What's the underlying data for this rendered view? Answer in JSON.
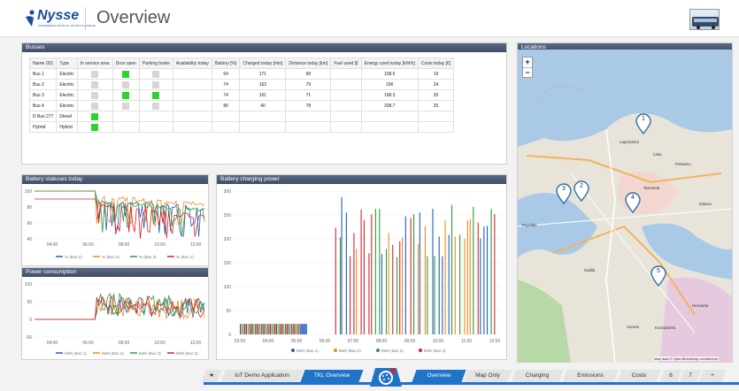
{
  "header": {
    "brand": "Nysse",
    "brand_sub": "TAMPEREEN SEUDUN JOUKKOLIIKENNE",
    "title": "Overview"
  },
  "busses_panel": {
    "title": "Busses",
    "columns": [
      "Name (ID)",
      "Type",
      "In service area",
      "Door open",
      "Parking brake",
      "Availability today",
      "Battery [%]",
      "Charged today [min]",
      "Distance today [km]",
      "Fuel used [l]",
      "Energy used today [kW/h]",
      "Costs today [€]"
    ],
    "rows": [
      {
        "name": "Bus 1",
        "type": "Electric",
        "in_service": "off",
        "door_open": "on",
        "parking_brake": "off",
        "availability": "",
        "battery": "64",
        "charged": "171",
        "distance": "68",
        "fuel": "",
        "energy": "158.5",
        "costs": "19"
      },
      {
        "name": "Bus 2",
        "type": "Electric",
        "in_service": "off",
        "door_open": "off",
        "parking_brake": "off",
        "availability": "",
        "battery": "74",
        "charged": "163",
        "distance": "79",
        "fuel": "",
        "energy": "196",
        "costs": "24"
      },
      {
        "name": "Bus 3",
        "type": "Electric",
        "in_service": "off",
        "door_open": "on",
        "parking_brake": "on",
        "availability": "",
        "battery": "74",
        "charged": "161",
        "distance": "71",
        "fuel": "",
        "energy": "168.3",
        "costs": "20"
      },
      {
        "name": "Bus 4",
        "type": "Electric",
        "in_service": "off",
        "door_open": "off",
        "parking_brake": "off",
        "availability": "",
        "battery": "80",
        "charged": "40",
        "distance": "78",
        "fuel": "",
        "energy": "208.7",
        "costs": "25"
      },
      {
        "name": "D Bus 277",
        "type": "Diesel",
        "in_service": "on",
        "door_open": "",
        "parking_brake": "",
        "availability": "",
        "battery": "",
        "charged": "",
        "distance": "",
        "fuel": "",
        "energy": "",
        "costs": ""
      },
      {
        "name": "Hybrid",
        "type": "Hybrid",
        "in_service": "on",
        "door_open": "",
        "parking_brake": "",
        "availability": "",
        "battery": "",
        "charged": "",
        "distance": "",
        "fuel": "",
        "energy": "",
        "costs": ""
      }
    ]
  },
  "battery_panel": {
    "title": "Battery statuses today"
  },
  "power_panel": {
    "title": "Power consumption"
  },
  "charging_panel": {
    "title": "Battery charging power"
  },
  "locations_panel": {
    "title": "Locations",
    "zoom_in": "+",
    "zoom_out": "−",
    "attribution": "Map data © OpenStreetMap contributors",
    "pins": [
      "1",
      "2",
      "3",
      "4",
      "5"
    ],
    "labels": [
      "Lapinniemi",
      "Lielu",
      "Petsamo",
      "Kaleva",
      "Tammela",
      "Pyynikki",
      "Hervanta",
      "Vuores",
      "Kovvaniemi",
      "Hallila"
    ]
  },
  "chart_data": [
    {
      "type": "line",
      "title": "Battery statuses today",
      "x": [
        "04:00",
        "06:00",
        "08:00",
        "10:00",
        "12:00"
      ],
      "ylim": [
        40,
        100
      ],
      "yticks": [
        100,
        80,
        60,
        40
      ],
      "series": [
        {
          "name": "% (Bus 2)",
          "color": "#1f5fb8",
          "values": [
            100,
            100,
            85,
            80,
            76
          ]
        },
        {
          "name": "% (Bus 4)",
          "color": "#f08a1c",
          "values": [
            100,
            100,
            90,
            82,
            80
          ]
        },
        {
          "name": "% (Bus 3)",
          "color": "#2a9d3c",
          "values": [
            100,
            100,
            82,
            77,
            74
          ]
        },
        {
          "name": "% (Bus 1)",
          "color": "#d6242b",
          "values": [
            90,
            90,
            80,
            70,
            64
          ]
        }
      ]
    },
    {
      "type": "line",
      "title": "Power consumption",
      "x": [
        "04:00",
        "06:00",
        "08:00",
        "10:00",
        "12:00"
      ],
      "ylim": [
        -50,
        100
      ],
      "yticks": [
        100,
        50,
        0,
        -50
      ],
      "series": [
        {
          "name": "kWh (Bus 1)",
          "color": "#1f5fb8",
          "values": [
            0,
            0,
            40,
            35,
            30
          ]
        },
        {
          "name": "kWh (Bus 4)",
          "color": "#f08a1c",
          "values": [
            0,
            0,
            35,
            30,
            30
          ]
        },
        {
          "name": "kWh (Bus 3)",
          "color": "#2a9d3c",
          "values": [
            0,
            0,
            45,
            40,
            35
          ]
        },
        {
          "name": "kWh (Bus 2)",
          "color": "#d6242b",
          "values": [
            0,
            0,
            40,
            40,
            35
          ]
        }
      ]
    },
    {
      "type": "bar",
      "title": "Battery charging power",
      "x": [
        "03:00",
        "04:00",
        "05:00",
        "06:00",
        "07:00",
        "08:00",
        "09:00",
        "10:00",
        "11:00",
        "12:00"
      ],
      "ylim": [
        0,
        300
      ],
      "yticks": [
        300,
        250,
        200,
        150,
        100,
        50,
        0
      ],
      "series": [
        {
          "name": "kWh (Bus 1)",
          "color": "#1f5fb8"
        },
        {
          "name": "kWh (Bus 2)",
          "color": "#f08a1c"
        },
        {
          "name": "kWh (Bus 3)",
          "color": "#2a9d3c"
        },
        {
          "name": "kWh (Bus 4)",
          "color": "#d6242b"
        }
      ]
    }
  ],
  "footer": {
    "tabs": [
      {
        "label": "★",
        "active": false
      },
      {
        "label": "IoT Demo Application",
        "active": false
      },
      {
        "label": "TKL Overview",
        "active": true
      },
      {
        "label": "Overview",
        "active": true
      },
      {
        "label": "Map Only",
        "active": false
      },
      {
        "label": "Charging",
        "active": false
      },
      {
        "label": "Emissions",
        "active": false
      },
      {
        "label": "Costs",
        "active": false
      },
      {
        "label": "6",
        "active": false
      },
      {
        "label": "7",
        "active": false
      },
      {
        "label": "+",
        "active": false
      }
    ]
  }
}
